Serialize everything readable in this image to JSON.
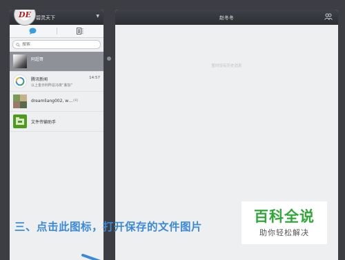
{
  "sidebar": {
    "logo_text": "DE",
    "user_name": "碧灵天下",
    "search_placeholder": "搜索",
    "chats": [
      {
        "name": "阿超哥",
        "subtitle": "",
        "time": "",
        "count": "",
        "thumb": "photo",
        "active": true
      },
      {
        "name": "腾讯新闻",
        "subtitle": "以上金日利昨总冯夜“紫加”",
        "time": "14:57",
        "count": "",
        "thumb": "qq-news"
      },
      {
        "name": "dreamliang002, w…",
        "subtitle": "",
        "time": "",
        "count": "(4)",
        "thumb": "group"
      },
      {
        "name": "文件传输助手",
        "subtitle": "",
        "time": "",
        "count": "",
        "thumb": "file-transfer"
      }
    ]
  },
  "chat": {
    "title": "赵冬冬",
    "empty_text": "暂时没有历史消息"
  },
  "overlay": {
    "instruction": "三、点击此图标，打开保存的文件图片",
    "watermark_title": "百科全说",
    "watermark_subtitle": "助你轻松解决"
  },
  "colors": {
    "header_bg": "#2f3136",
    "active_row": "#8f9198",
    "instruction_blue": "#3b8ad8",
    "watermark_green": "#2ea836"
  }
}
